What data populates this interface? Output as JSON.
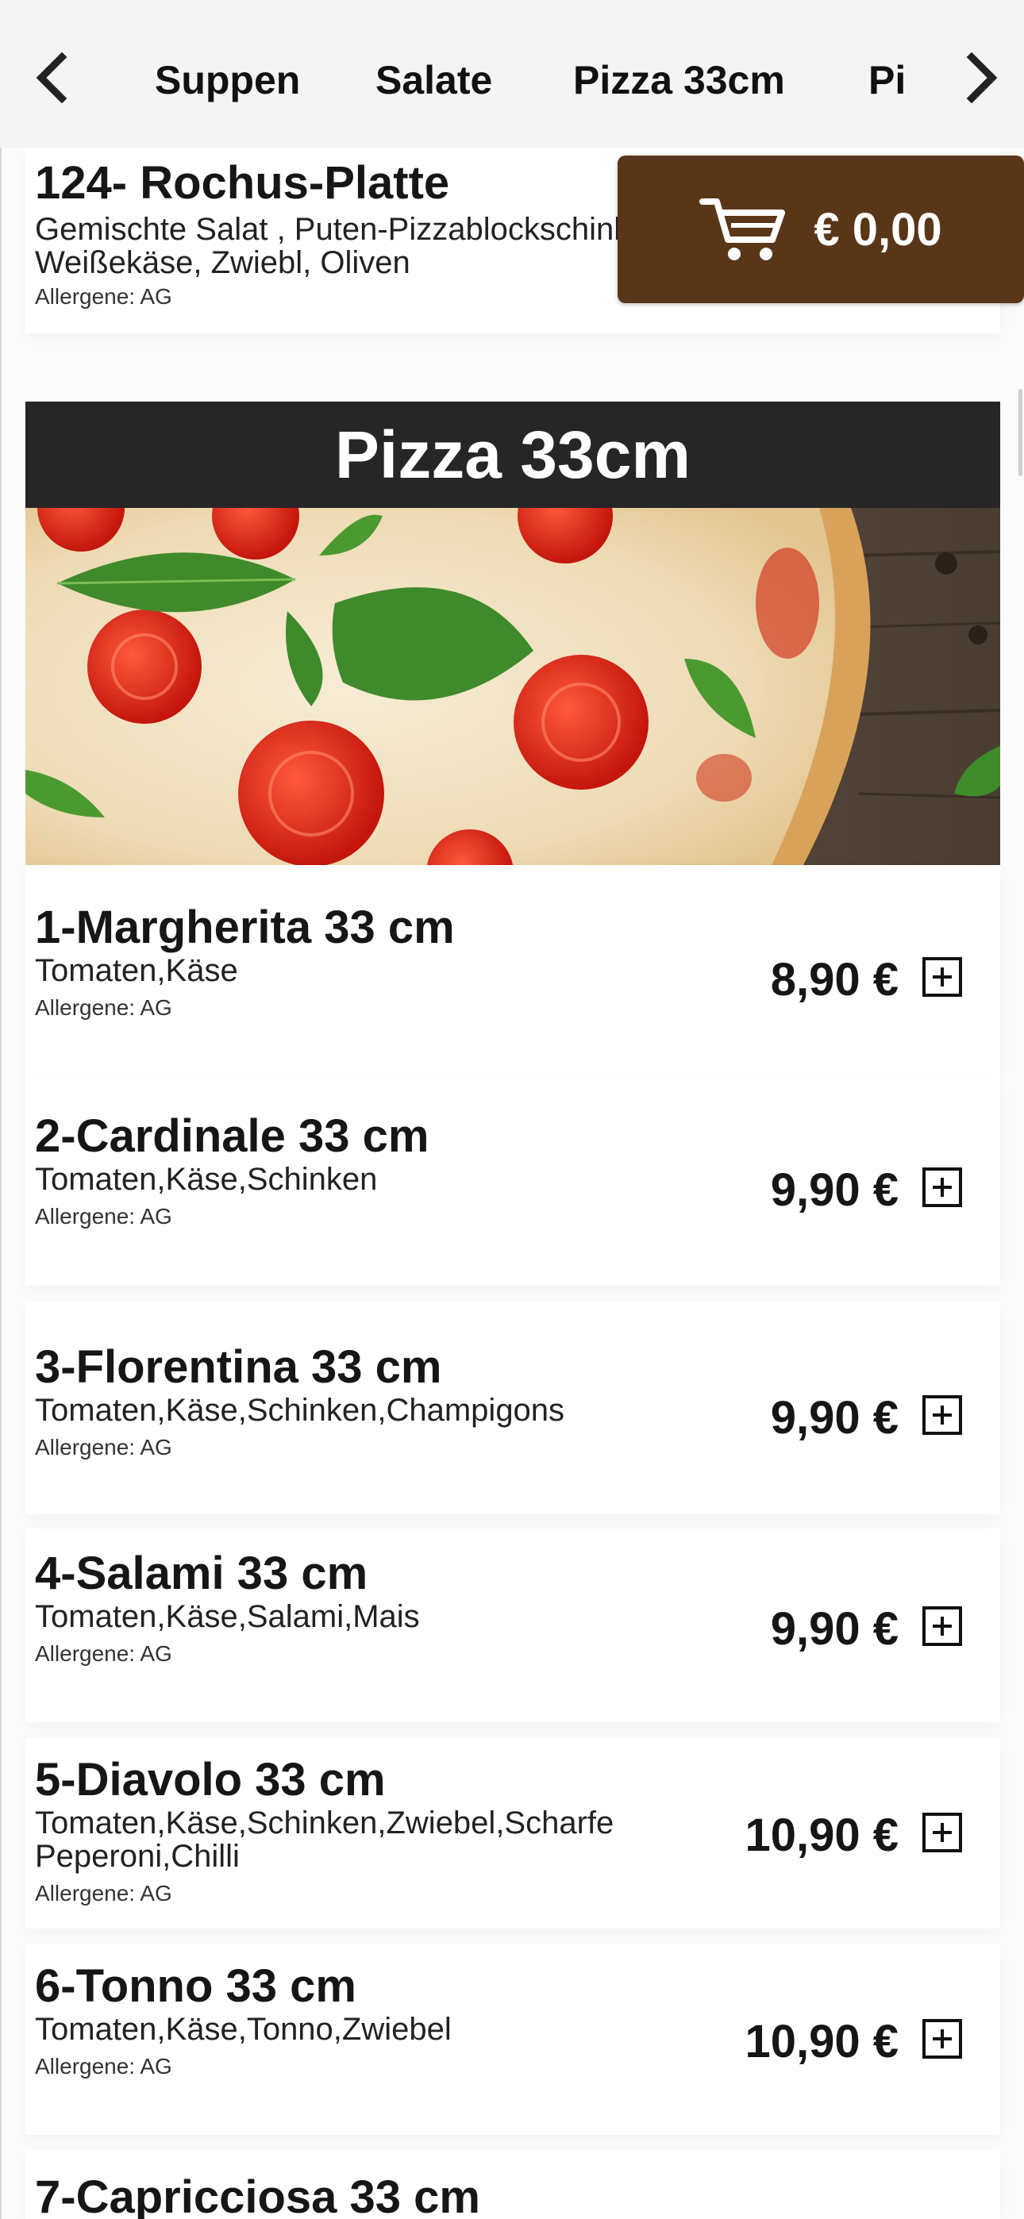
{
  "nav": {
    "tabs": [
      "Suppen",
      "Salate",
      "Pizza 33cm",
      "Pi"
    ],
    "left_icon": "chevron-left-icon",
    "right_icon": "chevron-right-icon"
  },
  "cart": {
    "icon": "shopping-cart-icon",
    "total": "€ 0,00"
  },
  "partial_item": {
    "name": "124- Rochus-Platte",
    "description": "Gemischte Salat , Puten-Pizzablockschinken, Weißekäse, Zwiebl, Oliven",
    "allergens": "Allergene: AG"
  },
  "section": {
    "title": "Pizza 33cm",
    "image": "pizza-margherita-photo"
  },
  "items": [
    {
      "name": "1-Margherita 33 cm",
      "description": "Tomaten,Käse",
      "allergens": "Allergene: AG",
      "price": "8,90 €"
    },
    {
      "name": "2-Cardinale 33 cm",
      "description": "Tomaten,Käse,Schinken",
      "allergens": "Allergene: AG",
      "price": "9,90 €"
    },
    {
      "name": "3-Florentina 33 cm",
      "description": "Tomaten,Käse,Schinken,Champigons",
      "allergens": "Allergene: AG",
      "price": "9,90 €"
    },
    {
      "name": "4-Salami 33 cm",
      "description": "Tomaten,Käse,Salami,Mais",
      "allergens": "Allergene: AG",
      "price": "9,90 €"
    },
    {
      "name": "5-Diavolo 33 cm",
      "description": "Tomaten,Käse,Schinken,Zwiebel,Scharfe Peperoni,Chilli",
      "allergens": "Allergene: AG",
      "price": "10,90 €"
    },
    {
      "name": "6-Tonno 33 cm",
      "description": "Tomaten,Käse,Tonno,Zwiebel",
      "allergens": "Allergene: AG",
      "price": "10,90 €"
    },
    {
      "name": "7-Capricciosa 33 cm"
    }
  ],
  "colors": {
    "cart_bg": "#5a3619",
    "section_header_bg": "#262626",
    "nav_bg": "#f4f4f4"
  }
}
